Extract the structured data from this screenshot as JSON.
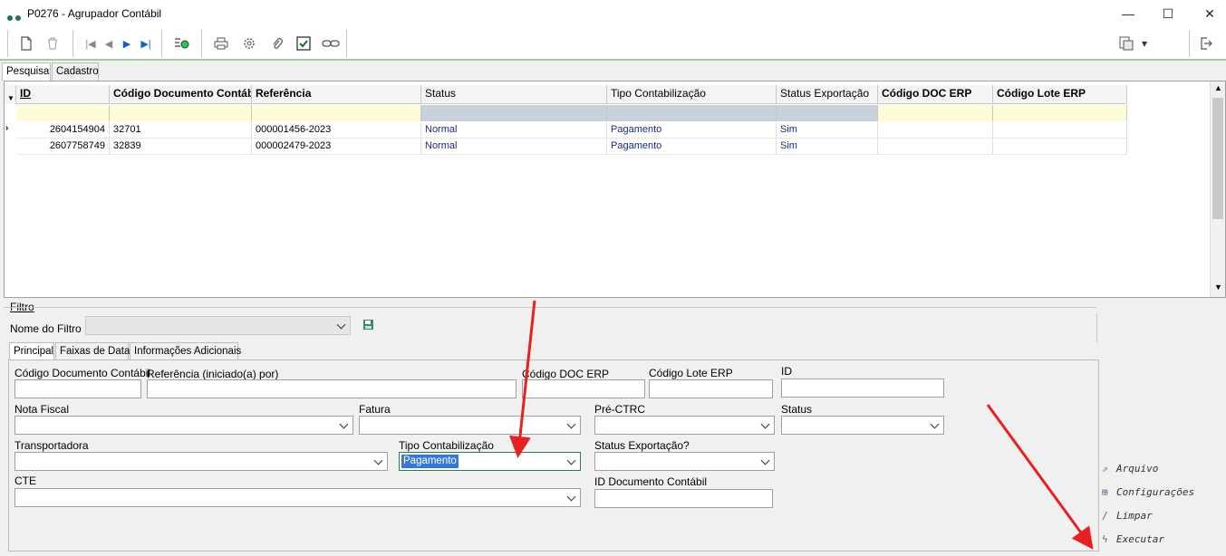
{
  "window": {
    "title": "P0276 - Agrupador Contábil",
    "minimize": "—",
    "maximize": "☐",
    "close": "✕"
  },
  "toolbar": {
    "dropdown_arrow": "▾"
  },
  "tabs_top": [
    "Pesquisa",
    "Cadastro"
  ],
  "grid": {
    "columns": [
      "ID",
      "Código Documento Contáb",
      "Referência",
      "Status",
      "Tipo Contabilização",
      "Status Exportação",
      "Código DOC ERP",
      "Código Lote ERP"
    ],
    "rows": [
      [
        "2604154904",
        "32701",
        "000001456-2023",
        "Normal",
        "Pagamento",
        "Sim",
        "",
        ""
      ],
      [
        "2607758749",
        "32839",
        "000002479-2023",
        "Normal",
        "Pagamento",
        "Sim",
        "",
        ""
      ]
    ]
  },
  "filter": {
    "section_label": "Filtro",
    "filter_name_label": "Nome do Filtro",
    "tabs": [
      "Principal",
      "Faixas de Data",
      "Informações Adicionais"
    ],
    "fields": {
      "codigo_documento_contabil": "Código Documento Contábil",
      "referencia": "Referência (iniciado(a) por)",
      "codigo_doc_erp": "Código DOC ERP",
      "codigo_lote_erp": "Código Lote ERP",
      "id": "ID",
      "nota_fiscal": "Nota Fiscal",
      "fatura": "Fatura",
      "pre_ctrc": "Pré-CTRC",
      "status": "Status",
      "transportadora": "Transportadora",
      "tipo_contabilizacao": "Tipo Contabilização",
      "tipo_contabilizacao_value": "Pagamento",
      "status_exportacao": "Status Exportação?",
      "cte": "CTE",
      "id_documento_contabil": "ID Documento Contábil"
    }
  },
  "actions": {
    "arquivo": "Arquivo",
    "configuracoes": "Configurações",
    "limpar": "Limpar",
    "executar": "Executar"
  }
}
